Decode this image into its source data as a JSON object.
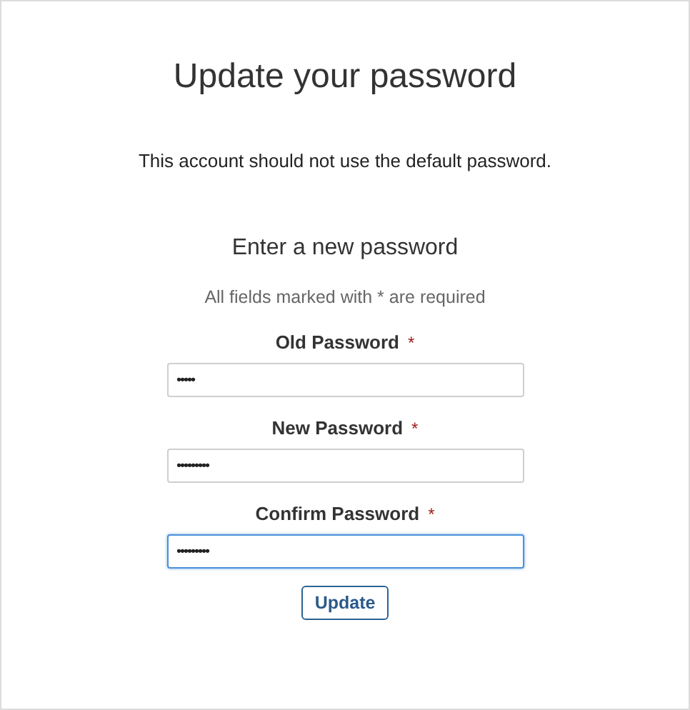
{
  "title": "Update your password",
  "notice": "This account should not use the default password.",
  "form": {
    "heading": "Enter a new password",
    "note": "All fields marked with * are required",
    "fields": [
      {
        "label": "Old Password",
        "required_mark": "*",
        "value": "•••••",
        "focused": false
      },
      {
        "label": "New Password",
        "required_mark": "*",
        "value": "•••••••••",
        "focused": false
      },
      {
        "label": "Confirm Password",
        "required_mark": "*",
        "value": "•••••••••",
        "focused": true
      }
    ],
    "submit": "Update"
  }
}
